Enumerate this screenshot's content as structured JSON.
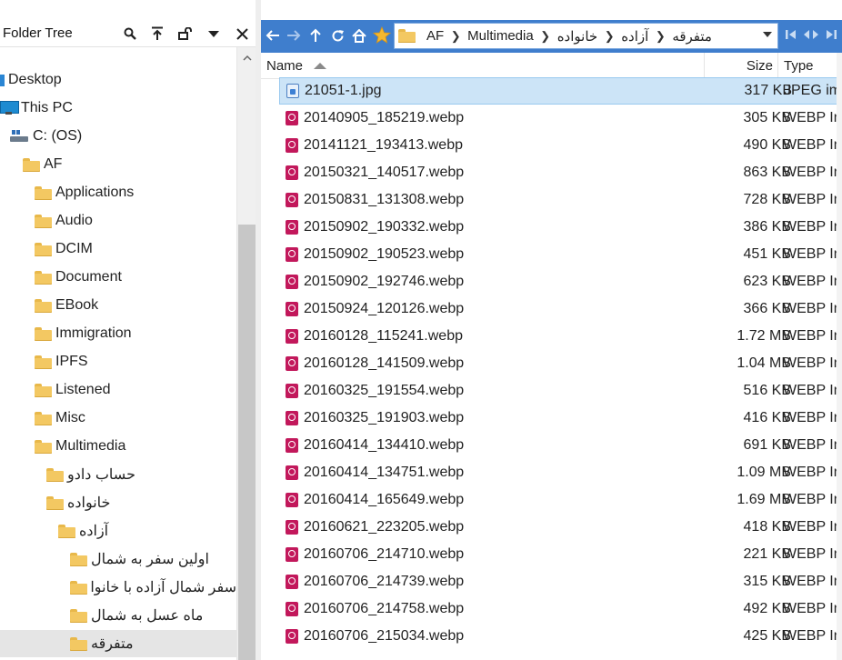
{
  "left_pane": {
    "title": "Folder Tree",
    "tree": [
      {
        "label": "Desktop",
        "icon": "desktop-icon",
        "level": 0
      },
      {
        "label": "This PC",
        "icon": "pc-icon",
        "level": 0
      },
      {
        "label": "C: (OS)",
        "icon": "drive-icon",
        "level": 1
      },
      {
        "label": "AF",
        "icon": "folder-icon",
        "level": 2
      },
      {
        "label": "Applications",
        "icon": "folder-icon",
        "level": 3
      },
      {
        "label": "Audio",
        "icon": "folder-icon",
        "level": 3
      },
      {
        "label": "DCIM",
        "icon": "folder-icon",
        "level": 3
      },
      {
        "label": "Document",
        "icon": "folder-icon",
        "level": 3
      },
      {
        "label": "EBook",
        "icon": "folder-icon",
        "level": 3
      },
      {
        "label": "Immigration",
        "icon": "folder-icon",
        "level": 3
      },
      {
        "label": "IPFS",
        "icon": "folder-icon",
        "level": 3
      },
      {
        "label": "Listened",
        "icon": "folder-icon",
        "level": 3
      },
      {
        "label": "Misc",
        "icon": "folder-icon",
        "level": 3
      },
      {
        "label": "Multimedia",
        "icon": "folder-icon",
        "level": 3
      },
      {
        "label": "حساب دادو",
        "icon": "folder-icon",
        "level": 4
      },
      {
        "label": "خانواده",
        "icon": "folder-icon",
        "level": 4
      },
      {
        "label": "آزاده",
        "icon": "folder-icon",
        "level": 5
      },
      {
        "label": "اولین سفر به شمال",
        "icon": "folder-icon",
        "level": 6
      },
      {
        "label": "سفر شمال آزاده با خانواده",
        "icon": "folder-icon",
        "level": 6
      },
      {
        "label": "ماه عسل به شمال",
        "icon": "folder-icon",
        "level": 6
      },
      {
        "label": "متفرقه",
        "icon": "folder-icon",
        "level": 6,
        "selected": true
      }
    ]
  },
  "address": {
    "breadcrumbs": [
      "AF",
      "Multimedia",
      "خانواده",
      "آزاده",
      "متفرقه"
    ]
  },
  "columns": {
    "name": "Name",
    "size": "Size",
    "type": "Type"
  },
  "files": [
    {
      "name": "21051-1.jpg",
      "size": "317 KB",
      "type": "JPEG image",
      "kind": "jpg",
      "selected": true
    },
    {
      "name": "20140905_185219.webp",
      "size": "305 KB",
      "type": "WEBP Image",
      "kind": "webp"
    },
    {
      "name": "20141121_193413.webp",
      "size": "490 KB",
      "type": "WEBP Image",
      "kind": "webp"
    },
    {
      "name": "20150321_140517.webp",
      "size": "863 KB",
      "type": "WEBP Image",
      "kind": "webp"
    },
    {
      "name": "20150831_131308.webp",
      "size": "728 KB",
      "type": "WEBP Image",
      "kind": "webp"
    },
    {
      "name": "20150902_190332.webp",
      "size": "386 KB",
      "type": "WEBP Image",
      "kind": "webp"
    },
    {
      "name": "20150902_190523.webp",
      "size": "451 KB",
      "type": "WEBP Image",
      "kind": "webp"
    },
    {
      "name": "20150902_192746.webp",
      "size": "623 KB",
      "type": "WEBP Image",
      "kind": "webp"
    },
    {
      "name": "20150924_120126.webp",
      "size": "366 KB",
      "type": "WEBP Image",
      "kind": "webp"
    },
    {
      "name": "20160128_115241.webp",
      "size": "1.72 MB",
      "type": "WEBP Image",
      "kind": "webp"
    },
    {
      "name": "20160128_141509.webp",
      "size": "1.04 MB",
      "type": "WEBP Image",
      "kind": "webp"
    },
    {
      "name": "20160325_191554.webp",
      "size": "516 KB",
      "type": "WEBP Image",
      "kind": "webp"
    },
    {
      "name": "20160325_191903.webp",
      "size": "416 KB",
      "type": "WEBP Image",
      "kind": "webp"
    },
    {
      "name": "20160414_134410.webp",
      "size": "691 KB",
      "type": "WEBP Image",
      "kind": "webp"
    },
    {
      "name": "20160414_134751.webp",
      "size": "1.09 MB",
      "type": "WEBP Image",
      "kind": "webp"
    },
    {
      "name": "20160414_165649.webp",
      "size": "1.69 MB",
      "type": "WEBP Image",
      "kind": "webp"
    },
    {
      "name": "20160621_223205.webp",
      "size": "418 KB",
      "type": "WEBP Image",
      "kind": "webp"
    },
    {
      "name": "20160706_214710.webp",
      "size": "221 KB",
      "type": "WEBP Image",
      "kind": "webp"
    },
    {
      "name": "20160706_214739.webp",
      "size": "315 KB",
      "type": "WEBP Image",
      "kind": "webp"
    },
    {
      "name": "20160706_214758.webp",
      "size": "492 KB",
      "type": "WEBP Image",
      "kind": "webp"
    },
    {
      "name": "20160706_215034.webp",
      "size": "425 KB",
      "type": "WEBP Image",
      "kind": "webp"
    }
  ],
  "colors": {
    "toolbar_blue": "#3f7ecd",
    "selection_blue": "#cce4f7",
    "tree_selected": "#e5e5e5",
    "webp_icon": "#c2185b",
    "folder_yellow": "#f3c862"
  }
}
